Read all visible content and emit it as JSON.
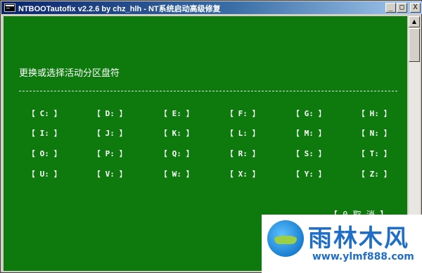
{
  "window": {
    "title": "NTBOOTautofix v2.2.6 by chz_hlh - NT系统启动高级修复",
    "controls": {
      "minimize": "_",
      "maximize": "□",
      "close": "X"
    }
  },
  "console": {
    "heading": "更换或选择活动分区盘符",
    "drives": [
      "C:",
      "D:",
      "E:",
      "F:",
      "G:",
      "H:",
      "I:",
      "J:",
      "K:",
      "L:",
      "M:",
      "N:",
      "O:",
      "P:",
      "Q:",
      "R:",
      "S:",
      "T:",
      "U:",
      "V:",
      "W:",
      "X:",
      "Y:",
      "Z:"
    ],
    "bracket_open": "【",
    "bracket_close": "】",
    "cancel": "【 0.取  消 】"
  },
  "colors": {
    "console_bg": "#0e7a0e",
    "console_text": "#ffffff",
    "title_bar": "#0a246a"
  },
  "watermark": {
    "brand": "雨林木风",
    "url": "www.ylmf888.com"
  }
}
